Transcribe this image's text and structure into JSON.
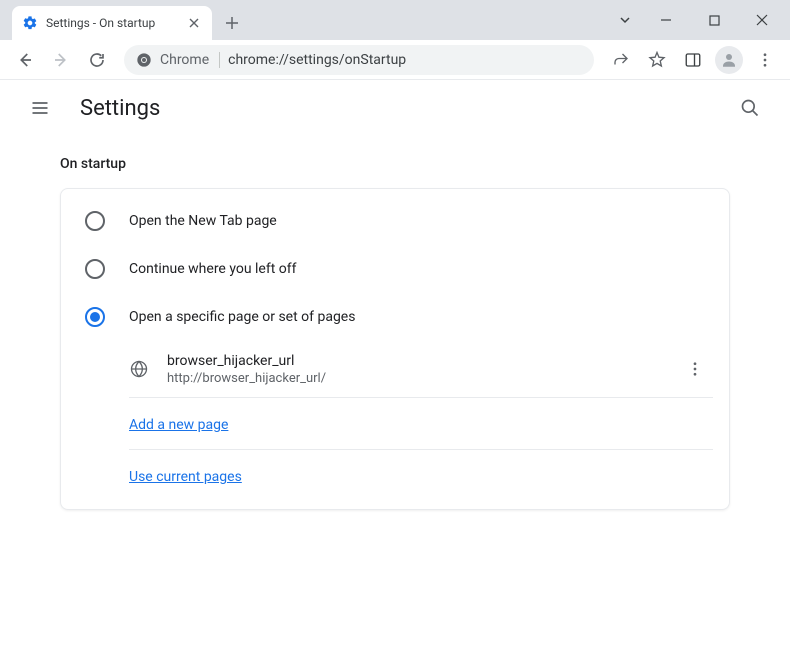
{
  "window": {
    "tab_title": "Settings - On startup"
  },
  "toolbar": {
    "omni_label": "Chrome",
    "omni_url": "chrome://settings/onStartup"
  },
  "page": {
    "title": "Settings",
    "section_title": "On startup",
    "options": {
      "new_tab": "Open the New Tab page",
      "continue": "Continue where you left off",
      "specific": "Open a specific page or set of pages"
    },
    "startup_pages": [
      {
        "name": "browser_hijacker_url",
        "url": "http://browser_hijacker_url/"
      }
    ],
    "add_page_link": "Add a new page",
    "use_current_link": "Use current pages"
  }
}
